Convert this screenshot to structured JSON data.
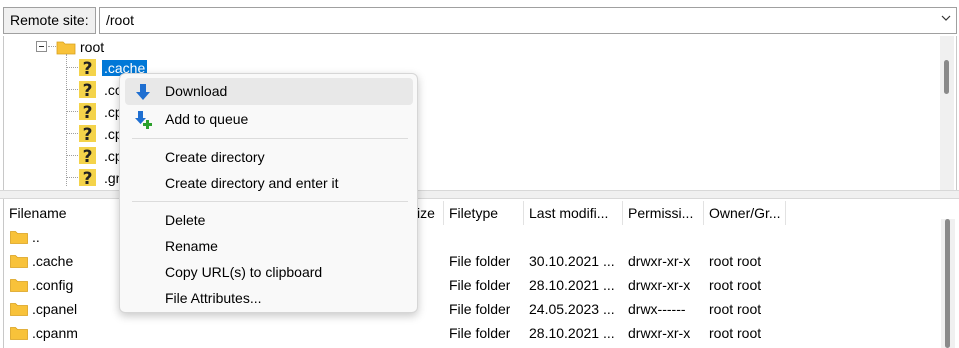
{
  "site_bar": {
    "label": "Remote site:",
    "path": "/root"
  },
  "tree": {
    "root_label": "root",
    "children": [
      {
        "label": ".cache",
        "selected": true
      },
      {
        "label": ".co"
      },
      {
        "label": ".cp"
      },
      {
        "label": ".cp"
      },
      {
        "label": ".cp"
      },
      {
        "label": ".gr"
      }
    ]
  },
  "file_list": {
    "columns": [
      "Filename",
      "ize",
      "Filetype",
      "Last modifi...",
      "Permissi...",
      "Owner/Gr..."
    ],
    "rows": [
      {
        "name": "..",
        "type": "",
        "modified": "",
        "perms": "",
        "owner": ""
      },
      {
        "name": ".cache",
        "type": "File folder",
        "modified": "30.10.2021 ...",
        "perms": "drwxr-xr-x",
        "owner": "root root"
      },
      {
        "name": ".config",
        "type": "File folder",
        "modified": "28.10.2021 ...",
        "perms": "drwxr-xr-x",
        "owner": "root root"
      },
      {
        "name": ".cpanel",
        "type": "File folder",
        "modified": "24.05.2023 ...",
        "perms": "drwx------",
        "owner": "root root"
      },
      {
        "name": ".cpanm",
        "type": "File folder",
        "modified": "28.10.2021 ...",
        "perms": "drwxr-xr-x",
        "owner": "root root"
      }
    ]
  },
  "context_menu": {
    "items": [
      {
        "label": "Download",
        "icon": "download-arrow-icon"
      },
      {
        "label": "Add to queue",
        "icon": "add-to-queue-icon"
      },
      {
        "label": "Create directory"
      },
      {
        "label": "Create directory and enter it"
      },
      {
        "label": "Delete"
      },
      {
        "label": "Rename"
      },
      {
        "label": "Copy URL(s) to clipboard"
      },
      {
        "label": "File Attributes..."
      }
    ]
  },
  "colors": {
    "selection": "#0078d7",
    "folder": "#f8c23a",
    "download_arrow": "#1f6fd1",
    "queue_plus": "#2ca02c"
  }
}
